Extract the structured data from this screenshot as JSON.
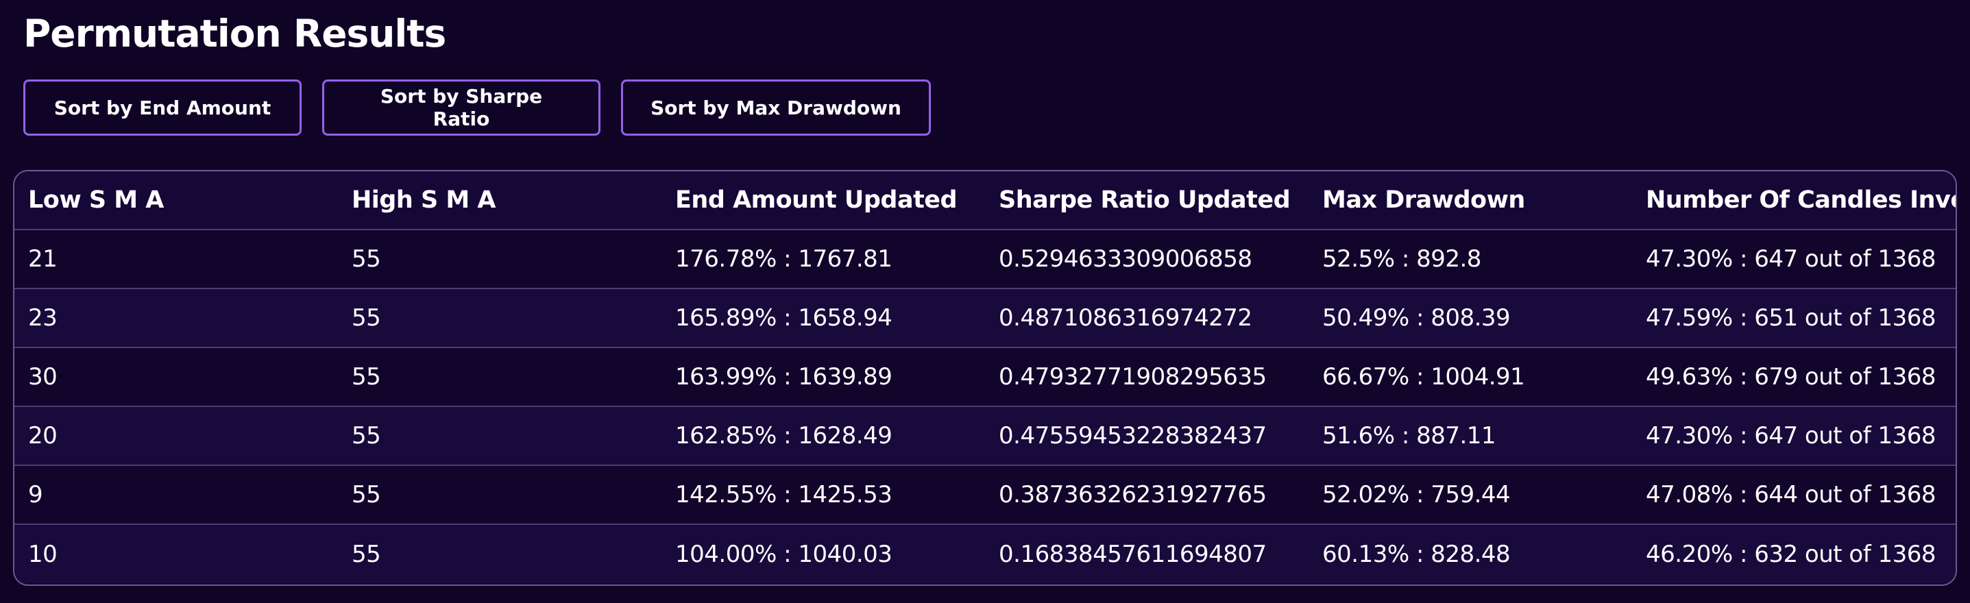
{
  "page": {
    "title": "Permutation Results"
  },
  "sort_buttons": {
    "end_amount": "Sort by End Amount",
    "sharpe_ratio": "Sort by Sharpe Ratio",
    "max_drawdown": "Sort by Max Drawdown"
  },
  "table": {
    "headers": [
      "Low S M A",
      "High S M A",
      "End Amount Updated",
      "Sharpe Ratio Updated",
      "Max Drawdown",
      "Number Of Candles Inve"
    ],
    "rows": [
      [
        "21",
        "55",
        "176.78% : 1767.81",
        "0.5294633309006858",
        "52.5% : 892.8",
        "47.30% : 647 out of 1368"
      ],
      [
        "23",
        "55",
        "165.89% : 1658.94",
        "0.4871086316974272",
        "50.49% : 808.39",
        "47.59% : 651 out of 1368"
      ],
      [
        "30",
        "55",
        "163.99% : 1639.89",
        "0.47932771908295635",
        "66.67% : 1004.91",
        "49.63% : 679 out of 1368"
      ],
      [
        "20",
        "55",
        "162.85% : 1628.49",
        "0.47559453228382437",
        "51.6% : 887.11",
        "47.30% : 647 out of 1368"
      ],
      [
        "9",
        "55",
        "142.55% : 1425.53",
        "0.38736326231927765",
        "52.02% : 759.44",
        "47.08% : 644 out of 1368"
      ],
      [
        "10",
        "55",
        "104.00% : 1040.03",
        "0.16838457611694807",
        "60.13% : 828.48",
        "46.20% : 632 out of 1368"
      ]
    ]
  },
  "colors": {
    "background": "#0f0426",
    "button_border": "#9561e8",
    "table_border": "#6b5a93",
    "row_divider": "#4b3f73",
    "text": "#ffffff"
  }
}
